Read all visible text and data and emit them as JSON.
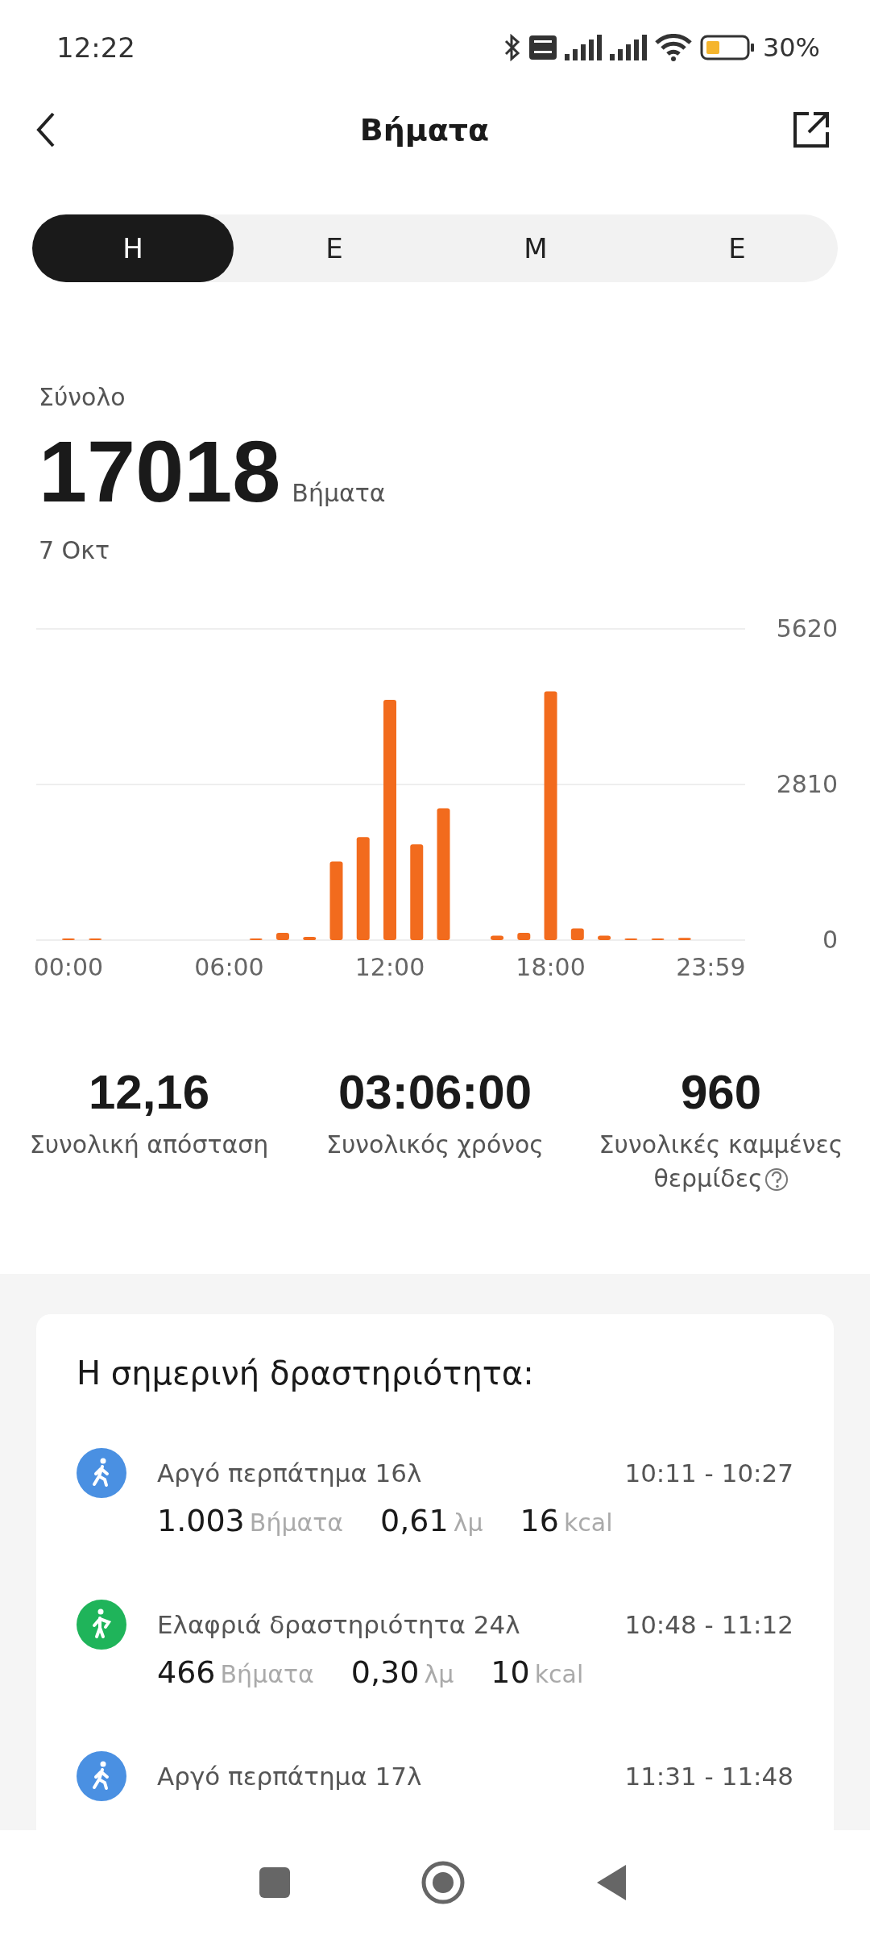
{
  "status_bar": {
    "time": "12:22",
    "battery": "30%"
  },
  "header": {
    "title": "Βήματα"
  },
  "tabs": [
    {
      "label": "Η",
      "selected": true
    },
    {
      "label": "Ε",
      "selected": false
    },
    {
      "label": "Μ",
      "selected": false
    },
    {
      "label": "Ε",
      "selected": false
    }
  ],
  "summary": {
    "label": "Σύνολο",
    "value": "17018",
    "unit": "Βήματα",
    "date": "7 Οκτ"
  },
  "chart_data": {
    "type": "bar",
    "x": [
      0,
      1,
      2,
      3,
      4,
      5,
      6,
      7,
      8,
      9,
      10,
      11,
      12,
      13,
      14,
      15,
      16,
      17,
      18,
      19,
      20,
      21,
      22,
      23
    ],
    "series": [
      {
        "color": "#f26b1d",
        "values": [
          10,
          10,
          0,
          0,
          0,
          0,
          0,
          10,
          130,
          60,
          1420,
          1860,
          4340,
          1730,
          2380,
          0,
          80,
          130,
          4490,
          210,
          80,
          30,
          10,
          40
        ]
      }
    ],
    "xlim": [
      -1.2,
      25.26
    ],
    "ylim": [
      0,
      5620
    ],
    "yticks": [
      0,
      2810,
      5620
    ],
    "xticks": [
      {
        "value": 0,
        "label": "00:00"
      },
      {
        "value": 6,
        "label": "06:00"
      },
      {
        "value": 12,
        "label": "12:00"
      },
      {
        "value": 18,
        "label": "18:00"
      },
      {
        "value": 23.98,
        "label": "23:59"
      }
    ]
  },
  "stats": [
    {
      "value": "12,16",
      "label": "Συνολική απόσταση",
      "help": false
    },
    {
      "value": "03:06:00",
      "label": "Συνολικός χρόνος",
      "help": false
    },
    {
      "value": "960",
      "label": "Συνολικές καμμένες θερμίδες",
      "help": true
    }
  ],
  "activity": {
    "title": "Η σημερινή δραστηριότητα:",
    "items": [
      {
        "kind": "walk",
        "color": "#4a90e2",
        "name": "Αργό περπάτημα 16λ",
        "time": "10:11 - 10:27",
        "metrics": [
          {
            "value": "1.003",
            "unit": "Βήματα"
          },
          {
            "value": "0,61",
            "unit": "λμ"
          },
          {
            "value": "16",
            "unit": "kcal"
          }
        ]
      },
      {
        "kind": "light",
        "color": "#1fb45a",
        "name": "Ελαφριά δραστηριότητα 24λ",
        "time": "10:48 - 11:12",
        "metrics": [
          {
            "value": "466",
            "unit": "Βήματα"
          },
          {
            "value": "0,30",
            "unit": "λμ"
          },
          {
            "value": "10",
            "unit": "kcal"
          }
        ]
      },
      {
        "kind": "walk",
        "color": "#4a90e2",
        "name": "Αργό περπάτημα 17λ",
        "time": "11:31 - 11:48"
      }
    ]
  }
}
